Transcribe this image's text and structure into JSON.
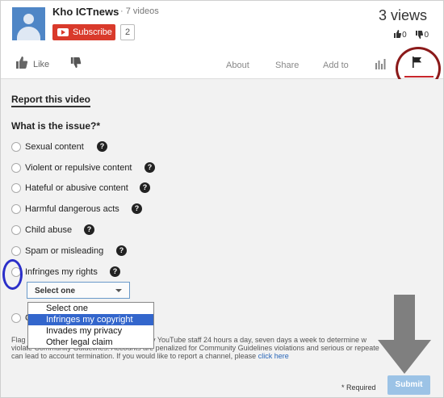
{
  "header": {
    "channel_name": "Kho ICTnews",
    "video_count": "· 7 videos",
    "subscribe_label": "Subscribe",
    "subscriber_count": "2",
    "views": "3 views",
    "likes_count": "0",
    "dislikes_count": "0"
  },
  "actions": {
    "like_label": "Like",
    "tabs": [
      "About",
      "Share",
      "Add to"
    ]
  },
  "report": {
    "title": "Report this video",
    "question": "What is the issue?*",
    "options": [
      "Sexual content",
      "Violent or repulsive content",
      "Hateful or abusive content",
      "Harmful dangerous acts",
      "Child abuse",
      "Spam or misleading",
      "Infringes my rights"
    ],
    "select_value": "Select one",
    "dropdown_options": [
      "Select one",
      "Infringes my copyright",
      "Invades my privacy",
      "Other legal claim"
    ],
    "dropdown_selected_index": 1,
    "partial_option_initial": "C",
    "flag_text_line1_start": "Flag",
    "flag_text_line1_end": "y YouTube staff 24 hours a day, seven days a week to determine w",
    "flag_text_line2": "violate Community Guidelines. Accounts are penalized for Community Guidelines violations and serious or repeate",
    "flag_text_line3": "can lead to account termination. If you would like to report a channel, please",
    "click_here": "click here",
    "required_note": "* Required",
    "submit_label": "Submit"
  },
  "icons": {
    "help": "?",
    "annotations": [
      "red-circle-around-flag",
      "blue-circle-around-radio",
      "gray-down-arrow-to-submit"
    ]
  },
  "colors": {
    "subscribe_red": "#d93a2b",
    "dropdown_highlight": "#3366cc",
    "submit_blue": "#9cc3e6",
    "annotation_red": "#8b1a1a",
    "annotation_blue": "#2b2fc9"
  }
}
